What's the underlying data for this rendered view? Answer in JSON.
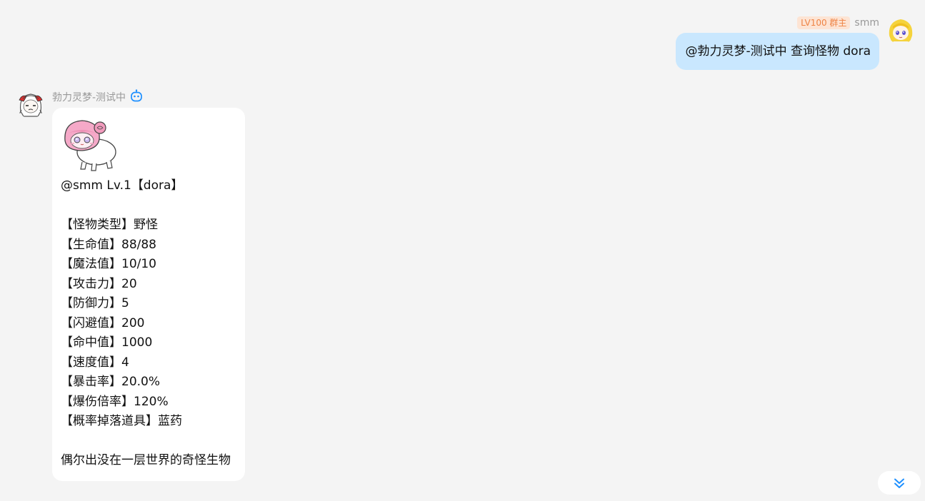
{
  "outgoing": {
    "badge": "LV100 群主",
    "nickname": "smm",
    "text": "@勃力灵梦-测试中 查询怪物 dora",
    "avatar_icon": "blonde-girl-avatar"
  },
  "incoming": {
    "nickname": "勃力灵梦-测试中",
    "bot_icon": "robot-icon",
    "avatar_icon": "white-hair-girl-avatar",
    "image_icon": "pink-hair-sheep-monster",
    "header": "@smm Lv.1【dora】",
    "stats": [
      "【怪物类型】野怪",
      "【生命值】88/88",
      "【魔法值】10/10",
      "【攻击力】20",
      "【防御力】5",
      "【闪避值】200",
      "【命中值】1000",
      "【速度值】4",
      "【暴击率】20.0%",
      "【爆伤倍率】120%",
      "【概率掉落道具】蓝药"
    ],
    "description": "偶尔出没在一层世界的奇怪生物"
  },
  "scroll_button": {
    "icon": "double-chevron-down-icon",
    "color": "#1e90ff"
  },
  "colors": {
    "background": "#f4f4f4",
    "bubble_out": "#c9e7fe",
    "bubble_in": "#ffffff",
    "badge_bg": "#fde4d4",
    "badge_text": "#ee8344"
  }
}
